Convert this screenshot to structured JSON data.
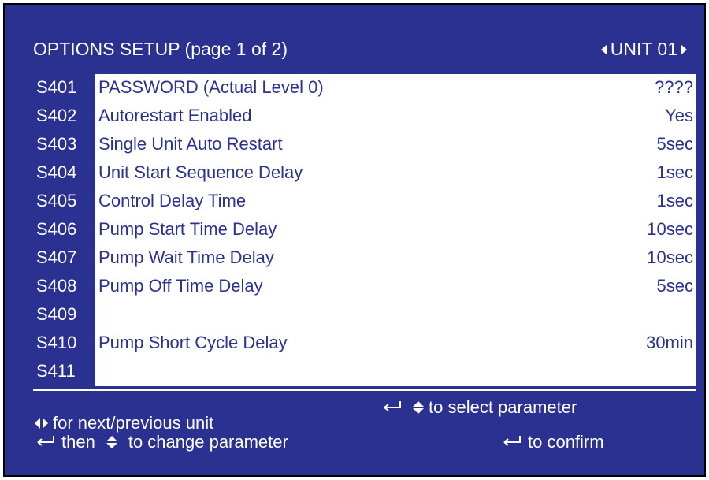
{
  "header": {
    "title": "OPTIONS SETUP (page 1 of 2)",
    "unit_label": "UNIT 01"
  },
  "parameters": [
    {
      "code": "S401",
      "name": "PASSWORD   (Actual Level  0)",
      "value": "????"
    },
    {
      "code": "S402",
      "name": "Autorestart Enabled",
      "value": "Yes"
    },
    {
      "code": "S403",
      "name": "Single Unit Auto Restart",
      "value": "5sec"
    },
    {
      "code": "S404",
      "name": "Unit Start Sequence Delay",
      "value": "1sec"
    },
    {
      "code": "S405",
      "name": "Control Delay Time",
      "value": "1sec"
    },
    {
      "code": "S406",
      "name": "Pump Start Time Delay",
      "value": "10sec"
    },
    {
      "code": "S407",
      "name": "Pump Wait Time Delay",
      "value": "10sec"
    },
    {
      "code": "S408",
      "name": "Pump Off Time Delay",
      "value": "5sec"
    },
    {
      "code": "S409",
      "name": "",
      "value": ""
    },
    {
      "code": "S410",
      "name": "Pump Short Cycle Delay",
      "value": "30min"
    },
    {
      "code": "S411",
      "name": "",
      "value": ""
    }
  ],
  "help": {
    "next_prev": "for next/previous unit",
    "select": "to select parameter",
    "then": "then",
    "change": "to change parameter",
    "confirm": "to confirm"
  },
  "colors": {
    "panel_blue": "#2b3190",
    "text_white": "#ffffff",
    "background_white": "#ffffff"
  }
}
